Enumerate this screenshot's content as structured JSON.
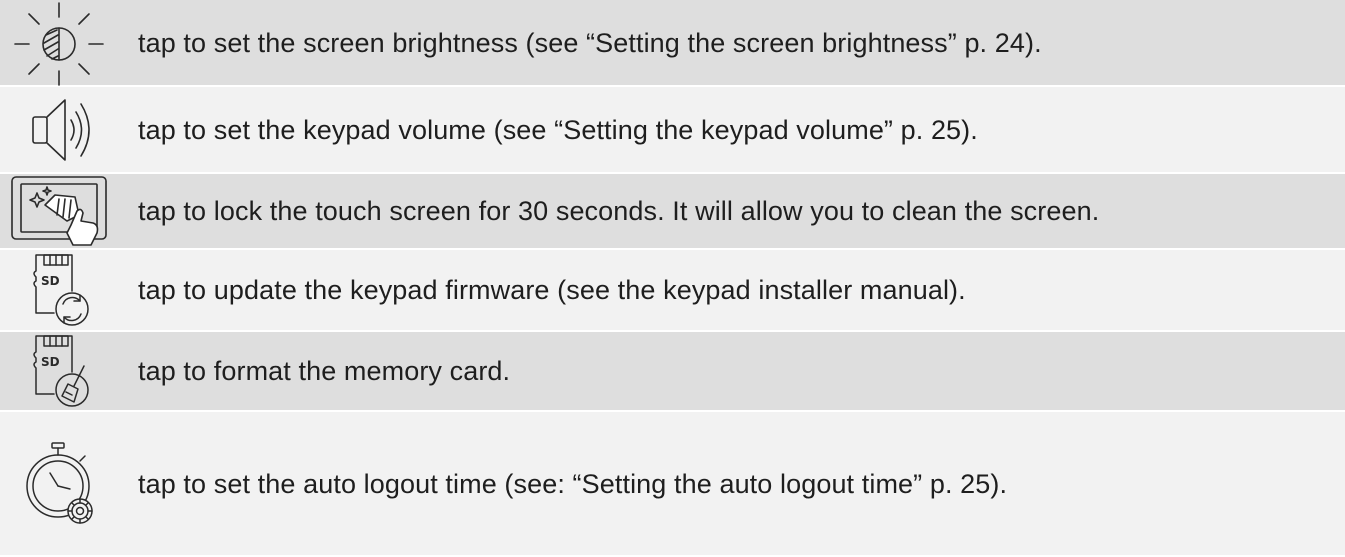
{
  "rows": [
    {
      "icon": "brightness-icon",
      "text": "tap to set the screen brightness (see “Setting the screen brightness” p. 24)."
    },
    {
      "icon": "speaker-volume-icon",
      "text": "tap to set the keypad volume (see “Setting the keypad volume” p. 25)."
    },
    {
      "icon": "screen-cleaning-icon",
      "text": "tap to lock the touch screen for 30 seconds. It will allow you to clean the screen."
    },
    {
      "icon": "sd-card-update-icon",
      "text": "tap to update the keypad firmware (see the keypad installer manual)."
    },
    {
      "icon": "sd-card-format-icon",
      "text": "tap to format the memory card."
    },
    {
      "icon": "stopwatch-settings-icon",
      "text": "tap to set the auto logout time (see: “Setting the auto logout time” p. 25)."
    }
  ],
  "sd_label": "SD"
}
